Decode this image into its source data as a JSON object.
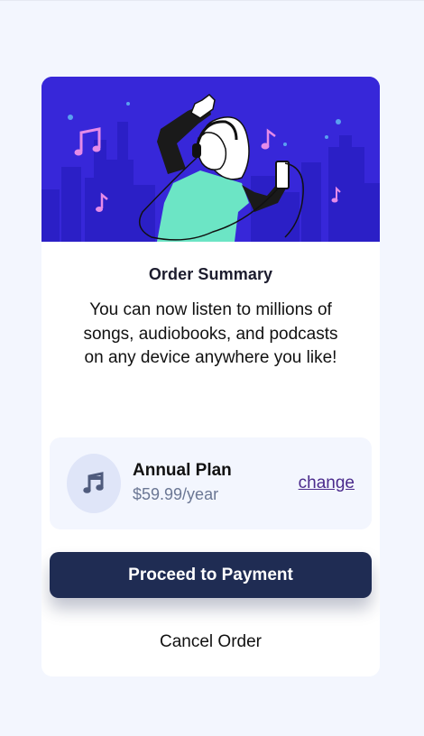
{
  "hero": {
    "illustration": "person-dancing-with-headphones-illustration"
  },
  "summary": {
    "title": "Order Summary",
    "description": "You can now listen to millions of songs, audiobooks, and podcasts on any device anywhere you like!"
  },
  "plan": {
    "icon": "music-note-icon",
    "name": "Annual Plan",
    "price": "$59.99/year",
    "change_label": "change"
  },
  "actions": {
    "proceed_label": "Proceed to Payment",
    "cancel_label": "Cancel Order"
  },
  "colors": {
    "page_background": "#f3f6fe",
    "hero_background": "#3727d9",
    "button_background": "#1f2c53",
    "link_color": "#4a2a8c",
    "price_color": "#6b7794"
  }
}
